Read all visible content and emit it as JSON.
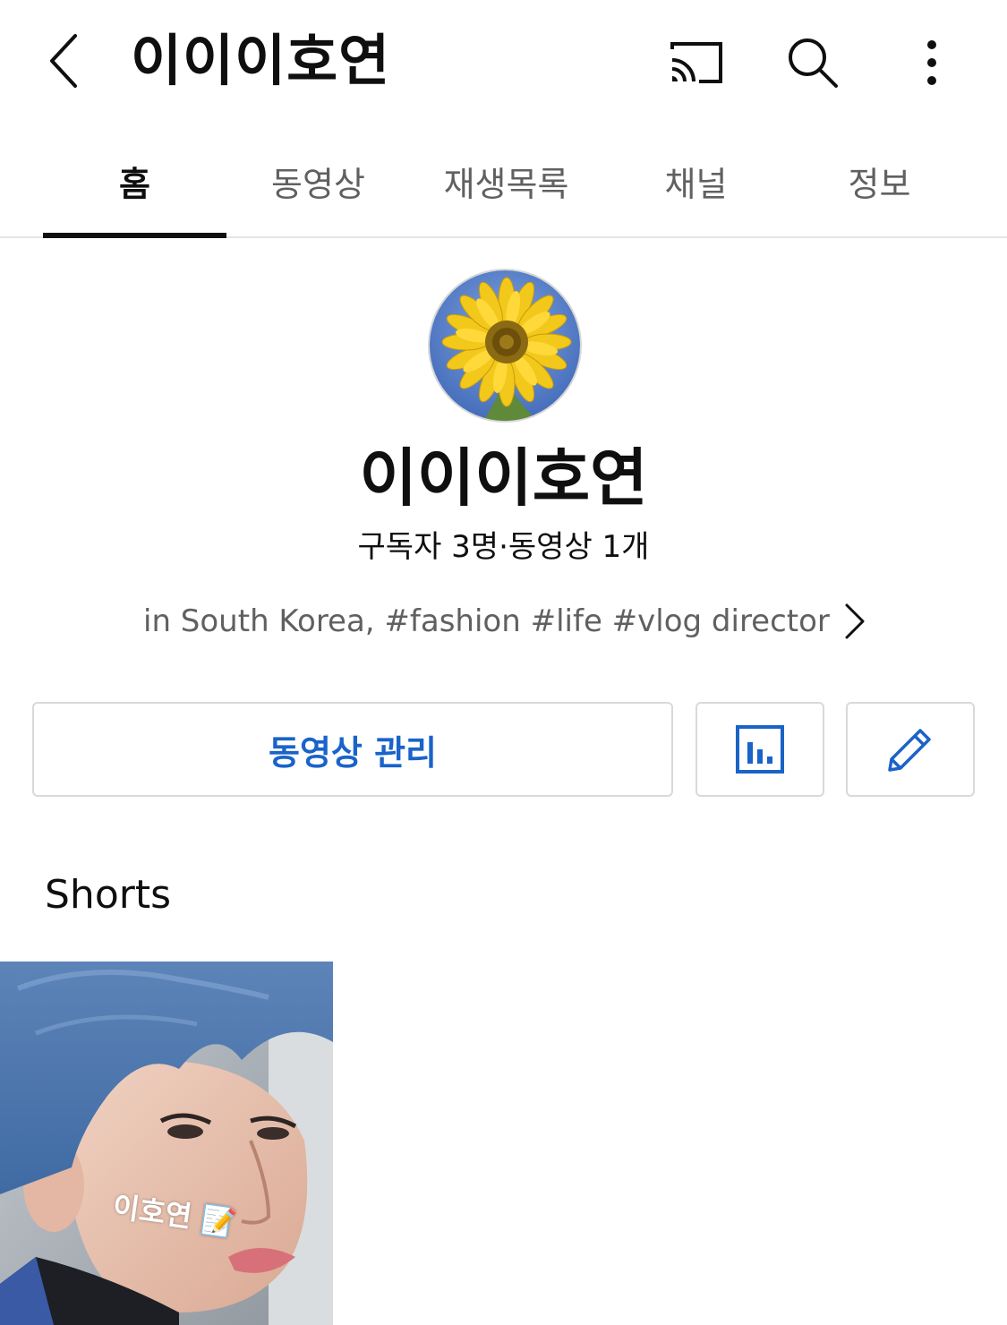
{
  "header": {
    "title": "이이이호연",
    "icons": {
      "back": "chevron-left-icon",
      "cast": "cast-icon",
      "search": "search-icon",
      "more": "more-vertical-icon"
    }
  },
  "tabs": [
    {
      "label": "홈",
      "active": true
    },
    {
      "label": "동영상",
      "active": false
    },
    {
      "label": "재생목록",
      "active": false
    },
    {
      "label": "채널",
      "active": false
    },
    {
      "label": "정보",
      "active": false
    }
  ],
  "channel": {
    "name": "이이이호연",
    "stats": "구독자 3명·동영상 1개",
    "description": "in South Korea, #fashion #life #vlog director",
    "avatar": "sunflower-avatar"
  },
  "actions": {
    "manage_label": "동영상 관리",
    "analytics_icon": "bar-chart-icon",
    "edit_icon": "pencil-icon"
  },
  "shorts": {
    "section_title": "Shorts",
    "items": [
      {
        "caption": "이호연 📝"
      }
    ]
  },
  "colors": {
    "accent_blue": "#1a63c9",
    "text_primary": "#0f0f0f",
    "text_secondary": "#606060",
    "divider": "#e5e5e5"
  }
}
